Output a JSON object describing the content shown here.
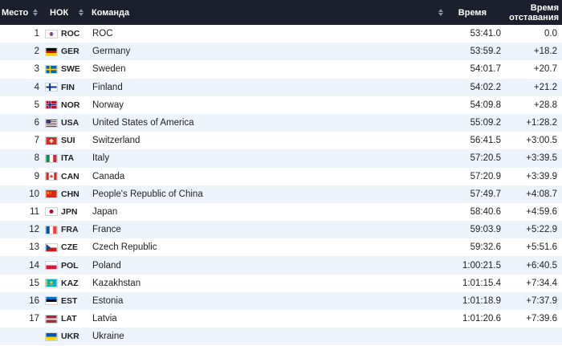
{
  "header": {
    "place": "Место",
    "noc": "НОК",
    "team": "Команда",
    "time": "Время",
    "gap_line1": "Время",
    "gap_line2": "отставания"
  },
  "rows": [
    {
      "rank": "1",
      "noc": "ROC",
      "team": "ROC",
      "time": "53:41.0",
      "gap": "0.0",
      "flag": "roc"
    },
    {
      "rank": "2",
      "noc": "GER",
      "team": "Germany",
      "time": "53:59.2",
      "gap": "+18.2",
      "flag": "ger"
    },
    {
      "rank": "3",
      "noc": "SWE",
      "team": "Sweden",
      "time": "54:01.7",
      "gap": "+20.7",
      "flag": "swe"
    },
    {
      "rank": "4",
      "noc": "FIN",
      "team": "Finland",
      "time": "54:02.2",
      "gap": "+21.2",
      "flag": "fin"
    },
    {
      "rank": "5",
      "noc": "NOR",
      "team": "Norway",
      "time": "54:09.8",
      "gap": "+28.8",
      "flag": "nor"
    },
    {
      "rank": "6",
      "noc": "USA",
      "team": "United States of America",
      "time": "55:09.2",
      "gap": "+1:28.2",
      "flag": "usa"
    },
    {
      "rank": "7",
      "noc": "SUI",
      "team": "Switzerland",
      "time": "56:41.5",
      "gap": "+3:00.5",
      "flag": "sui"
    },
    {
      "rank": "8",
      "noc": "ITA",
      "team": "Italy",
      "time": "57:20.5",
      "gap": "+3:39.5",
      "flag": "ita"
    },
    {
      "rank": "9",
      "noc": "CAN",
      "team": "Canada",
      "time": "57:20.9",
      "gap": "+3:39.9",
      "flag": "can"
    },
    {
      "rank": "10",
      "noc": "CHN",
      "team": "People's Republic of China",
      "time": "57:49.7",
      "gap": "+4:08.7",
      "flag": "chn"
    },
    {
      "rank": "11",
      "noc": "JPN",
      "team": "Japan",
      "time": "58:40.6",
      "gap": "+4:59.6",
      "flag": "jpn"
    },
    {
      "rank": "12",
      "noc": "FRA",
      "team": "France",
      "time": "59:03.9",
      "gap": "+5:22.9",
      "flag": "fra"
    },
    {
      "rank": "13",
      "noc": "CZE",
      "team": "Czech Republic",
      "time": "59:32.6",
      "gap": "+5:51.6",
      "flag": "cze"
    },
    {
      "rank": "14",
      "noc": "POL",
      "team": "Poland",
      "time": "1:00:21.5",
      "gap": "+6:40.5",
      "flag": "pol"
    },
    {
      "rank": "15",
      "noc": "KAZ",
      "team": "Kazakhstan",
      "time": "1:01:15.4",
      "gap": "+7:34.4",
      "flag": "kaz"
    },
    {
      "rank": "16",
      "noc": "EST",
      "team": "Estonia",
      "time": "1:01:18.9",
      "gap": "+7:37.9",
      "flag": "est"
    },
    {
      "rank": "17",
      "noc": "LAT",
      "team": "Latvia",
      "time": "1:01:20.6",
      "gap": "+7:39.6",
      "flag": "lat"
    },
    {
      "rank": "",
      "noc": "UKR",
      "team": "Ukraine",
      "time": "",
      "gap": "",
      "flag": "ukr"
    }
  ],
  "colors": {
    "header_bg": "#1c1f2d",
    "row_alt": "#eef4fc",
    "sort_icon": "#8a8fa3"
  }
}
